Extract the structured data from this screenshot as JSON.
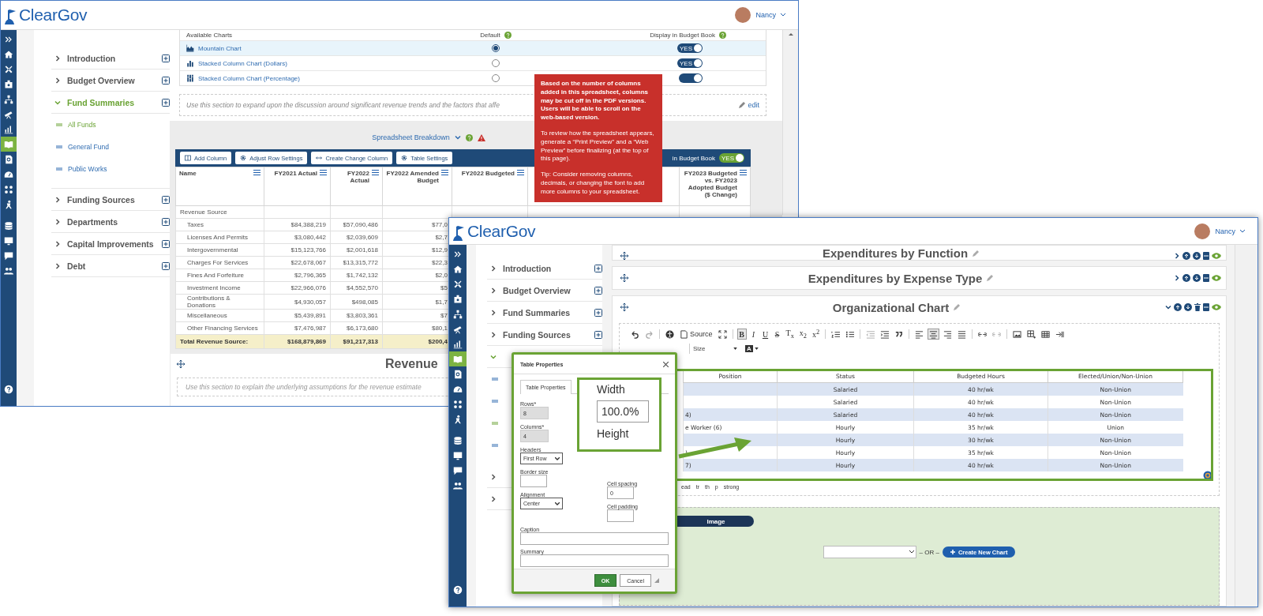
{
  "back_window": {
    "header": {
      "logo": "ClearGov",
      "user": "Nancy"
    },
    "sidebar": [
      {
        "kind": "expand",
        "selected": false
      },
      {
        "kind": "home",
        "selected": false
      },
      {
        "kind": "tools",
        "selected": false
      },
      {
        "kind": "badge",
        "selected": false
      },
      {
        "kind": "org",
        "selected": false
      },
      {
        "kind": "telescope",
        "selected": false
      },
      {
        "kind": "chart",
        "selected": false
      },
      {
        "kind": "book",
        "selected": true
      },
      {
        "kind": "docsearch",
        "selected": false
      },
      {
        "kind": "gauge",
        "selected": false
      },
      {
        "kind": "dots",
        "selected": false
      },
      {
        "kind": "figure",
        "selected": false
      },
      {
        "kind": "database",
        "selected": false
      },
      {
        "kind": "monitor",
        "selected": false
      },
      {
        "kind": "chat",
        "selected": false
      },
      {
        "kind": "people",
        "selected": false
      },
      {
        "kind": "help",
        "selected": false
      }
    ],
    "nav": [
      {
        "label": "Introduction",
        "expanded": false
      },
      {
        "label": "Budget Overview",
        "expanded": false
      },
      {
        "label": "Fund Summaries",
        "expanded": true,
        "children": [
          {
            "label": "All Funds",
            "selected": true
          },
          {
            "label": "General Fund",
            "selected": false
          },
          {
            "label": "Public Works",
            "selected": false
          }
        ]
      },
      {
        "label": "Funding Sources",
        "expanded": false
      },
      {
        "label": "Departments",
        "expanded": false
      },
      {
        "label": "Capital Improvements",
        "expanded": false
      },
      {
        "label": "Debt",
        "expanded": false
      }
    ],
    "charts": {
      "columns": [
        "Available Charts",
        "Default",
        "Display in Budget Book"
      ],
      "rows": [
        {
          "kind": "mountain",
          "name": "Mountain Chart",
          "selected": true,
          "display": true,
          "toggle_label": "YES"
        },
        {
          "kind": "stacked",
          "name": "Stacked Column Chart (Dollars)",
          "selected": false,
          "display": true,
          "toggle_label": "YES"
        },
        {
          "kind": "percent",
          "name": "Stacked Column Chart (Percentage)",
          "selected": false,
          "display": true
        }
      ]
    },
    "note": "Use this section to expand upon the discussion around significant revenue trends and the factors that affe",
    "edit_link": "edit",
    "breakdown": {
      "title": "Spreadsheet Breakdown"
    },
    "tooltip": [
      "Based on the number of columns added in this spreadsheet, columns may be cut off in the PDF versions. Users will be able to scroll on the web-based version.",
      "To review how the spreadsheet appears, generate a “Print Preview” and a “Web Preview” before finalizing (at the top of this page).",
      "Tip: Consider removing columns, decimals, or changing the font to add more columns to your spreadsheet."
    ],
    "toolbar": {
      "buttons": [
        {
          "kind": "columns",
          "label": "Add Column"
        },
        {
          "kind": "gear",
          "label": "Adjust Row Settings"
        },
        {
          "kind": "arrows",
          "label": "Create Change Column"
        },
        {
          "kind": "gear",
          "label": "Table Settings"
        }
      ],
      "show_label": "in Budget Book",
      "show_on": true,
      "show_toggle": "YES"
    },
    "table": {
      "columns": [
        "Name",
        "FY2021 Actual",
        "FY2022 Actual",
        "FY2022 Amended Budget",
        "FY2022 Budgeted",
        "",
        "FY2023 Budgeted vs. FY2023 Adopted Budget ($ Change)"
      ],
      "rows": [
        {
          "kind": "group",
          "cells": [
            "Revenue Source"
          ]
        },
        {
          "kind": "item",
          "cells": [
            "Taxes",
            "$84,388,219",
            "$57,090,486",
            "$77,0"
          ]
        },
        {
          "kind": "item",
          "cells": [
            "Licenses And Permits",
            "$3,080,442",
            "$2,039,609",
            "$2,7"
          ]
        },
        {
          "kind": "item",
          "cells": [
            "Intergovernmental",
            "$15,123,766",
            "$2,001,618",
            "$12,9"
          ]
        },
        {
          "kind": "item",
          "cells": [
            "Charges For Services",
            "$22,678,067",
            "$13,315,772",
            "$22,3"
          ]
        },
        {
          "kind": "item",
          "cells": [
            "Fines And Forfeiture",
            "$2,796,365",
            "$1,742,132",
            "$2,0"
          ]
        },
        {
          "kind": "item",
          "cells": [
            "Investment Income",
            "$22,966,076",
            "$4,552,570",
            "$5"
          ]
        },
        {
          "kind": "item",
          "cells": [
            "Contributions & Donations",
            "$4,930,057",
            "$498,085",
            "$1,7"
          ]
        },
        {
          "kind": "item",
          "cells": [
            "Miscellaneous",
            "$5,439,891",
            "$3,803,361",
            "$7"
          ]
        },
        {
          "kind": "item",
          "cells": [
            "Other Financing Services",
            "$7,476,987",
            "$6,173,680",
            "$80,1"
          ]
        },
        {
          "kind": "total",
          "cells": [
            "Total Revenue Source:",
            "$168,879,869",
            "$91,217,313",
            "$200,4"
          ]
        }
      ]
    },
    "section": {
      "title": "Revenue",
      "note": "Use this section to explain the underlying assumptions for the revenue estimate"
    }
  },
  "front_window": {
    "header": {
      "logo": "ClearGov",
      "user": "Nancy"
    },
    "sidebar": [
      {
        "kind": "expand",
        "selected": false
      },
      {
        "kind": "home",
        "selected": false
      },
      {
        "kind": "tools",
        "selected": false
      },
      {
        "kind": "badge",
        "selected": false
      },
      {
        "kind": "org",
        "selected": false
      },
      {
        "kind": "telescope",
        "selected": false
      },
      {
        "kind": "chart",
        "selected": false
      },
      {
        "kind": "book",
        "selected": true
      },
      {
        "kind": "docsearch",
        "selected": false
      },
      {
        "kind": "gauge",
        "selected": false
      },
      {
        "kind": "dots",
        "selected": false
      },
      {
        "kind": "figure",
        "selected": false
      },
      {
        "kind": "database",
        "selected": false
      },
      {
        "kind": "monitor",
        "selected": false
      },
      {
        "kind": "chat",
        "selected": false
      },
      {
        "kind": "people",
        "selected": false
      },
      {
        "kind": "help",
        "selected": false
      }
    ],
    "nav": [
      {
        "label": "Introduction",
        "expanded": false
      },
      {
        "label": "Budget Overview",
        "expanded": false
      },
      {
        "label": "Fund Summaries",
        "expanded": false
      },
      {
        "label": "Funding Sources",
        "expanded": false
      },
      {
        "expanded": true,
        "children": [
          {
            "selected": false
          },
          {
            "selected": false
          },
          {
            "selected": true
          },
          {
            "selected": false
          }
        ]
      },
      {
        "expanded": false
      },
      {
        "expanded": false
      }
    ],
    "sections": [
      {
        "title": "Expenditures by Function",
        "expanded": false
      },
      {
        "title": "Expenditures by Expense Type",
        "expanded": false
      },
      {
        "title": "Organizational Chart",
        "expanded": true
      }
    ],
    "editor": {
      "toolbar": [
        {
          "kind": "undo",
          "selected": false
        },
        {
          "kind": "redo",
          "selected": false
        },
        {
          "kind": "sep"
        },
        {
          "kind": "a11y",
          "selected": false
        },
        {
          "kind": "source",
          "label": "Source",
          "selected": false
        },
        {
          "kind": "maximize",
          "selected": false
        },
        {
          "kind": "sep"
        },
        {
          "kind": "text",
          "label": "B",
          "selected": true
        },
        {
          "kind": "text",
          "label": "I",
          "selected": false
        },
        {
          "kind": "text",
          "label": "U",
          "selected": false
        },
        {
          "kind": "text",
          "label": "S",
          "selected": false
        },
        {
          "kind": "text",
          "label": "T$_{x}$",
          "selected": false
        },
        {
          "kind": "text",
          "label": "x$_{2}$",
          "selected": false
        },
        {
          "kind": "text",
          "label": "x$^{2}$",
          "selected": false
        },
        {
          "kind": "sep"
        },
        {
          "kind": "numlist",
          "selected": false
        },
        {
          "kind": "bullist",
          "selected": false
        },
        {
          "kind": "sep"
        },
        {
          "kind": "outdent",
          "selected": false
        },
        {
          "kind": "indent",
          "selected": false
        },
        {
          "kind": "quote",
          "selected": false
        },
        {
          "kind": "sep"
        },
        {
          "kind": "alignleft",
          "selected": false
        },
        {
          "kind": "aligncenter",
          "selected": true
        },
        {
          "kind": "alignright",
          "selected": false
        },
        {
          "kind": "justify",
          "selected": false
        },
        {
          "kind": "sep"
        },
        {
          "kind": "link",
          "selected": false
        },
        {
          "kind": "unlink",
          "selected": false
        },
        {
          "kind": "sep"
        },
        {
          "kind": "image",
          "selected": false
        },
        {
          "kind": "tableadd",
          "selected": false
        },
        {
          "kind": "table",
          "selected": false
        },
        {
          "kind": "pagebreak",
          "selected": false
        }
      ],
      "size": "Size",
      "color_button": "A",
      "table": {
        "columns": [
          "Position",
          "Status",
          "Budgeted Hours",
          "Elected/Union/Non-Union"
        ],
        "rows": [
          {
            "status": "Salaried",
            "hours": "40 hr/wk",
            "union": "Non-Union"
          },
          {
            "status": "Salaried",
            "hours": "40 hr/wk",
            "union": "Non-Union"
          },
          {
            "position": "4)",
            "status": "Salaried",
            "hours": "40 hr/wk",
            "union": "Non-Union"
          },
          {
            "position": "e Worker (6)",
            "status": "Hourly",
            "hours": "35 hr/wk",
            "union": "Union"
          },
          {
            "status": "Hourly",
            "hours": "30 hr/wk",
            "union": "Non-Union"
          },
          {
            "position": ")",
            "status": "Hourly",
            "hours": "35 hr/wk",
            "union": "Non-Union"
          },
          {
            "position": "7)",
            "status": "Hourly",
            "hours": "40 hr/wk",
            "union": "Non-Union"
          }
        ]
      },
      "path": [
        "ead",
        "tr",
        "th",
        "p",
        "strong"
      ]
    },
    "chart_picker": {
      "toggle": "Image",
      "separator": "– OR –",
      "create": "Create New Chart"
    },
    "dialog": {
      "title": "Table Properties",
      "tab": {
        "label": "Table Properties",
        "selected": true
      },
      "left_fields": [
        {
          "kind": "text",
          "label": "Rows*",
          "value": "8",
          "disabled": true
        },
        {
          "kind": "text",
          "label": "Columns*",
          "value": "4",
          "disabled": true
        },
        {
          "kind": "select",
          "label": "Headers",
          "value": "First Row",
          "disabled": false
        },
        {
          "kind": "text",
          "label": "Border size",
          "disabled": false
        },
        {
          "kind": "select",
          "label": "Alignment",
          "value": "Center",
          "disabled": false
        }
      ],
      "right_fields": [
        {
          "kind": "text",
          "label": "Cell spacing",
          "value": "0",
          "disabled": false
        },
        {
          "kind": "text",
          "label": "Cell padding",
          "disabled": false
        }
      ],
      "wide_fields": [
        {
          "kind": "text",
          "label": "Caption",
          "disabled": false
        },
        {
          "kind": "text",
          "label": "Summary",
          "disabled": false
        }
      ],
      "buttons": [
        {
          "kind": "primary",
          "label": "OK"
        },
        {
          "kind": "secondary",
          "label": "Cancel"
        }
      ]
    },
    "callout": {
      "width_label": "Width",
      "width_value": "100.0%",
      "height_label": "Height"
    }
  }
}
